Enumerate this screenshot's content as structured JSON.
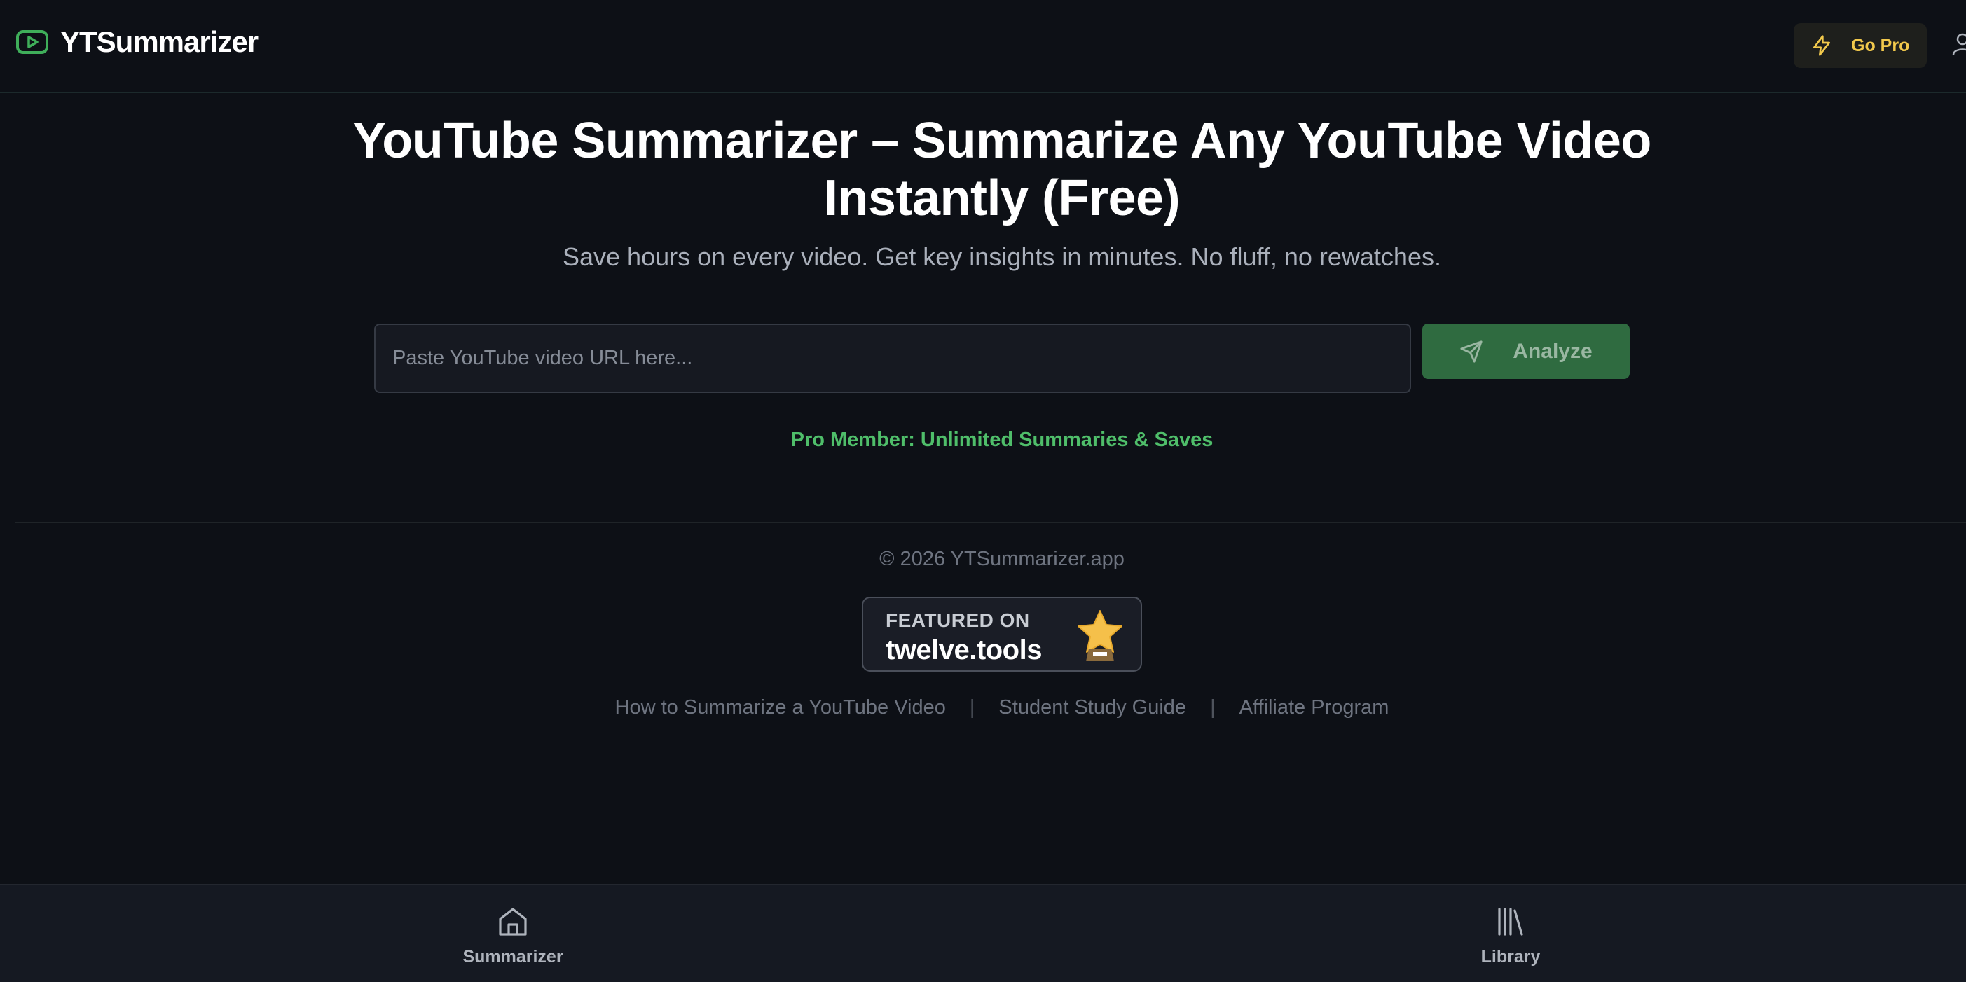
{
  "header": {
    "brand_name": "YTSummarizer",
    "go_pro_label": "Go Pro",
    "icons": {
      "brand": "play-square-icon",
      "go_pro": "lightning-icon",
      "account": "user-icon"
    },
    "colors": {
      "brand_icon": "#3fae5a",
      "go_pro_text": "#f2c94c"
    }
  },
  "hero": {
    "title": "YouTube Summarizer – Summarize Any YouTube Video Instantly (Free)",
    "subtitle": "Save hours on every video. Get key insights in minutes. No fluff, no rewatches.",
    "url_input": {
      "value": "",
      "placeholder": "Paste YouTube video URL here..."
    },
    "analyze_label": "Analyze",
    "analyze_icon": "send-icon",
    "pro_member_text": "Pro Member: Unlimited Summaries & Saves",
    "colors": {
      "accent": "#2f6b40",
      "pro_text": "#4fbe6a"
    }
  },
  "footer": {
    "copyright": "© 2026 YTSummarizer.app",
    "featured_badge": {
      "small_text": "FEATURED ON",
      "big_text": "twelve.tools",
      "icon": "trophy-star-icon"
    },
    "links": [
      {
        "label": "How to Summarize a YouTube Video"
      },
      {
        "label": "Student Study Guide"
      },
      {
        "label": "Affiliate Program"
      }
    ],
    "separator": "|"
  },
  "bottom_nav": {
    "items": [
      {
        "label": "Summarizer",
        "icon": "home-icon"
      },
      {
        "label": "Library",
        "icon": "library-icon"
      }
    ]
  }
}
